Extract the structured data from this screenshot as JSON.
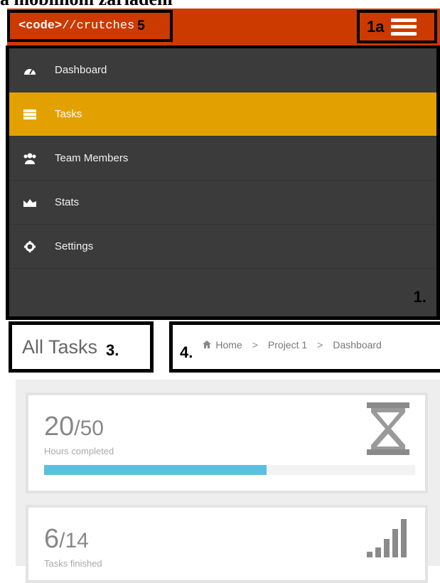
{
  "caption": "a mobilnom zariadení",
  "header": {
    "brand_tag": "<code>",
    "brand_rest": "//crutches",
    "brand_annotation": "5",
    "menu_annotation": "1a",
    "menu_icon": "hamburger-icon",
    "color": "#cc3a00"
  },
  "sidebar": {
    "annotation": "1.",
    "items": [
      {
        "label": "Dashboard",
        "icon": "dashboard-icon",
        "active": false
      },
      {
        "label": "Tasks",
        "icon": "tasks-icon",
        "active": true
      },
      {
        "label": "Team Members",
        "icon": "team-icon",
        "active": false
      },
      {
        "label": "Stats",
        "icon": "stats-icon",
        "active": false
      },
      {
        "label": "Settings",
        "icon": "gear-icon",
        "active": false
      }
    ],
    "active_color": "#e3a100"
  },
  "page": {
    "title": "All Tasks",
    "title_annotation": "3.",
    "breadcrumb_annotation": "4.",
    "breadcrumb": [
      "Home",
      "Project 1",
      "Dashboard"
    ],
    "breadcrumb_separator": ">"
  },
  "cards": [
    {
      "value": "20",
      "total": "/50",
      "label": "Hours completed",
      "progress": 0.6,
      "icon": "hourglass-icon",
      "progress_color": "#5bc0de"
    },
    {
      "value": "6",
      "total": "/14",
      "label": "Tasks finished",
      "icon": "signal-bars-icon"
    }
  ]
}
